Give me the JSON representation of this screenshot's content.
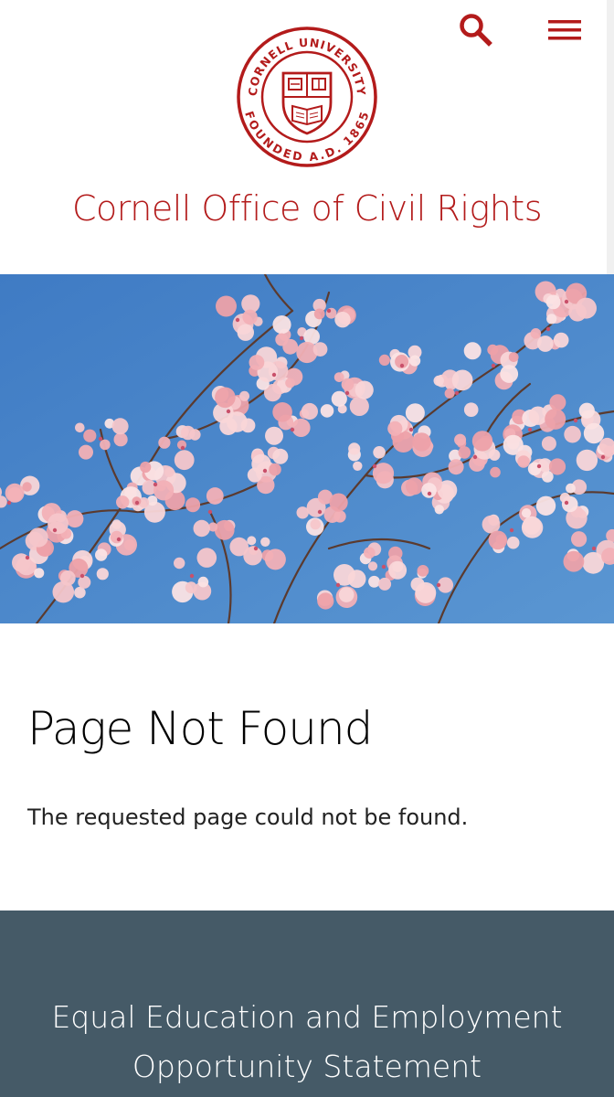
{
  "header": {
    "seal_text_top": "CORNELL UNIVERSITY",
    "seal_text_bottom": "FOUNDED A.D. 1865",
    "site_title": "Cornell Office of Civil Rights",
    "search_icon": "search-icon",
    "menu_icon": "hamburger-menu-icon"
  },
  "hero": {
    "image_subject": "pink cherry blossoms against blue sky"
  },
  "main": {
    "title": "Page Not Found",
    "message": "The requested page could not be found."
  },
  "footer": {
    "heading_line1": "Equal Education and Employment",
    "heading_line2": "Opportunity Statement"
  },
  "colors": {
    "brand_red": "#b31b1b",
    "footer_bg": "#455a67",
    "sky_blue": "#4a86c8",
    "blossom_pink": "#f2b8bc"
  }
}
